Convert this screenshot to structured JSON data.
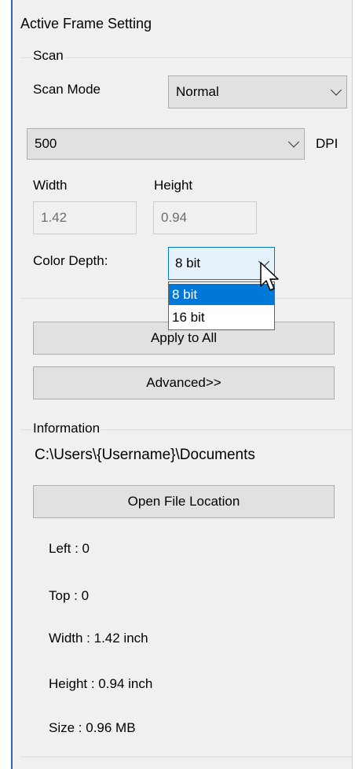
{
  "panel": {
    "title": "Active Frame Setting"
  },
  "scan": {
    "group_label": "Scan",
    "scan_mode_label": "Scan Mode",
    "scan_mode_value": "Normal",
    "dpi_value": "500",
    "dpi_label": "DPI",
    "width_label": "Width",
    "height_label": "Height",
    "width_value": "1.42",
    "height_value": "0.94",
    "color_depth_label": "Color Depth:",
    "color_depth_value": "8 bit",
    "color_depth_options": [
      "8 bit",
      "16 bit"
    ]
  },
  "buttons": {
    "apply_to_all": "Apply to All",
    "advanced": "Advanced>>",
    "open_file_location": "Open File Location"
  },
  "information": {
    "group_label": "Information",
    "path": "C:\\Users\\{Username}\\Documents",
    "left": "Left : 0",
    "top": "Top : 0",
    "width": "Width : 1.42 inch",
    "height": "Height : 0.94 inch",
    "size": "Size : 0.96 MB"
  },
  "icons": {
    "chevron": "chevron-down-icon",
    "cursor": "mouse-pointer-icon"
  },
  "colors": {
    "selection": "#0078d7",
    "window_border": "#2b63c8",
    "panel_bg": "#f0f0f0"
  }
}
